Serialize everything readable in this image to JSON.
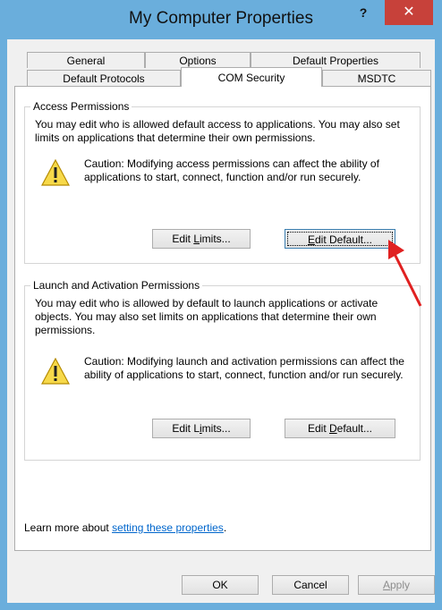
{
  "window": {
    "title": "My Computer Properties",
    "help_glyph": "?",
    "close_glyph": "✕"
  },
  "tabs_row1": [
    "General",
    "Options",
    "Default Properties"
  ],
  "tabs_row2": [
    "Default Protocols",
    "COM Security",
    "MSDTC"
  ],
  "access": {
    "label": "Access Permissions",
    "desc": "You may edit who is allowed default access to applications. You may also set limits on applications that determine their own permissions.",
    "caution": "Caution: Modifying access permissions can affect the ability of applications to start, connect, function and/or run securely.",
    "edit_limits": {
      "pre": "Edit ",
      "key": "L",
      "post": "imits..."
    },
    "edit_default": {
      "pre": "",
      "key": "E",
      "post": "dit Default..."
    }
  },
  "launch": {
    "label": "Launch and Activation Permissions",
    "desc": "You may edit who is allowed by default to launch applications or activate objects. You may also set limits on applications that determine their own permissions.",
    "caution": "Caution: Modifying launch and activation permissions can affect the ability of applications to start, connect, function and/or run securely.",
    "edit_limits": {
      "pre": "Edit L",
      "key": "i",
      "post": "mits..."
    },
    "edit_default": {
      "pre": "Edit ",
      "key": "D",
      "post": "efault..."
    }
  },
  "learn_more": {
    "prefix": "Learn more about ",
    "link": "setting these properties",
    "suffix": "."
  },
  "footer": {
    "ok": "OK",
    "cancel": "Cancel",
    "apply": {
      "pre": "",
      "key": "A",
      "post": "pply"
    }
  },
  "colors": {
    "frame": "#6aaedc",
    "close": "#c7413a",
    "link": "#0066cc",
    "arrow": "#e02020"
  }
}
